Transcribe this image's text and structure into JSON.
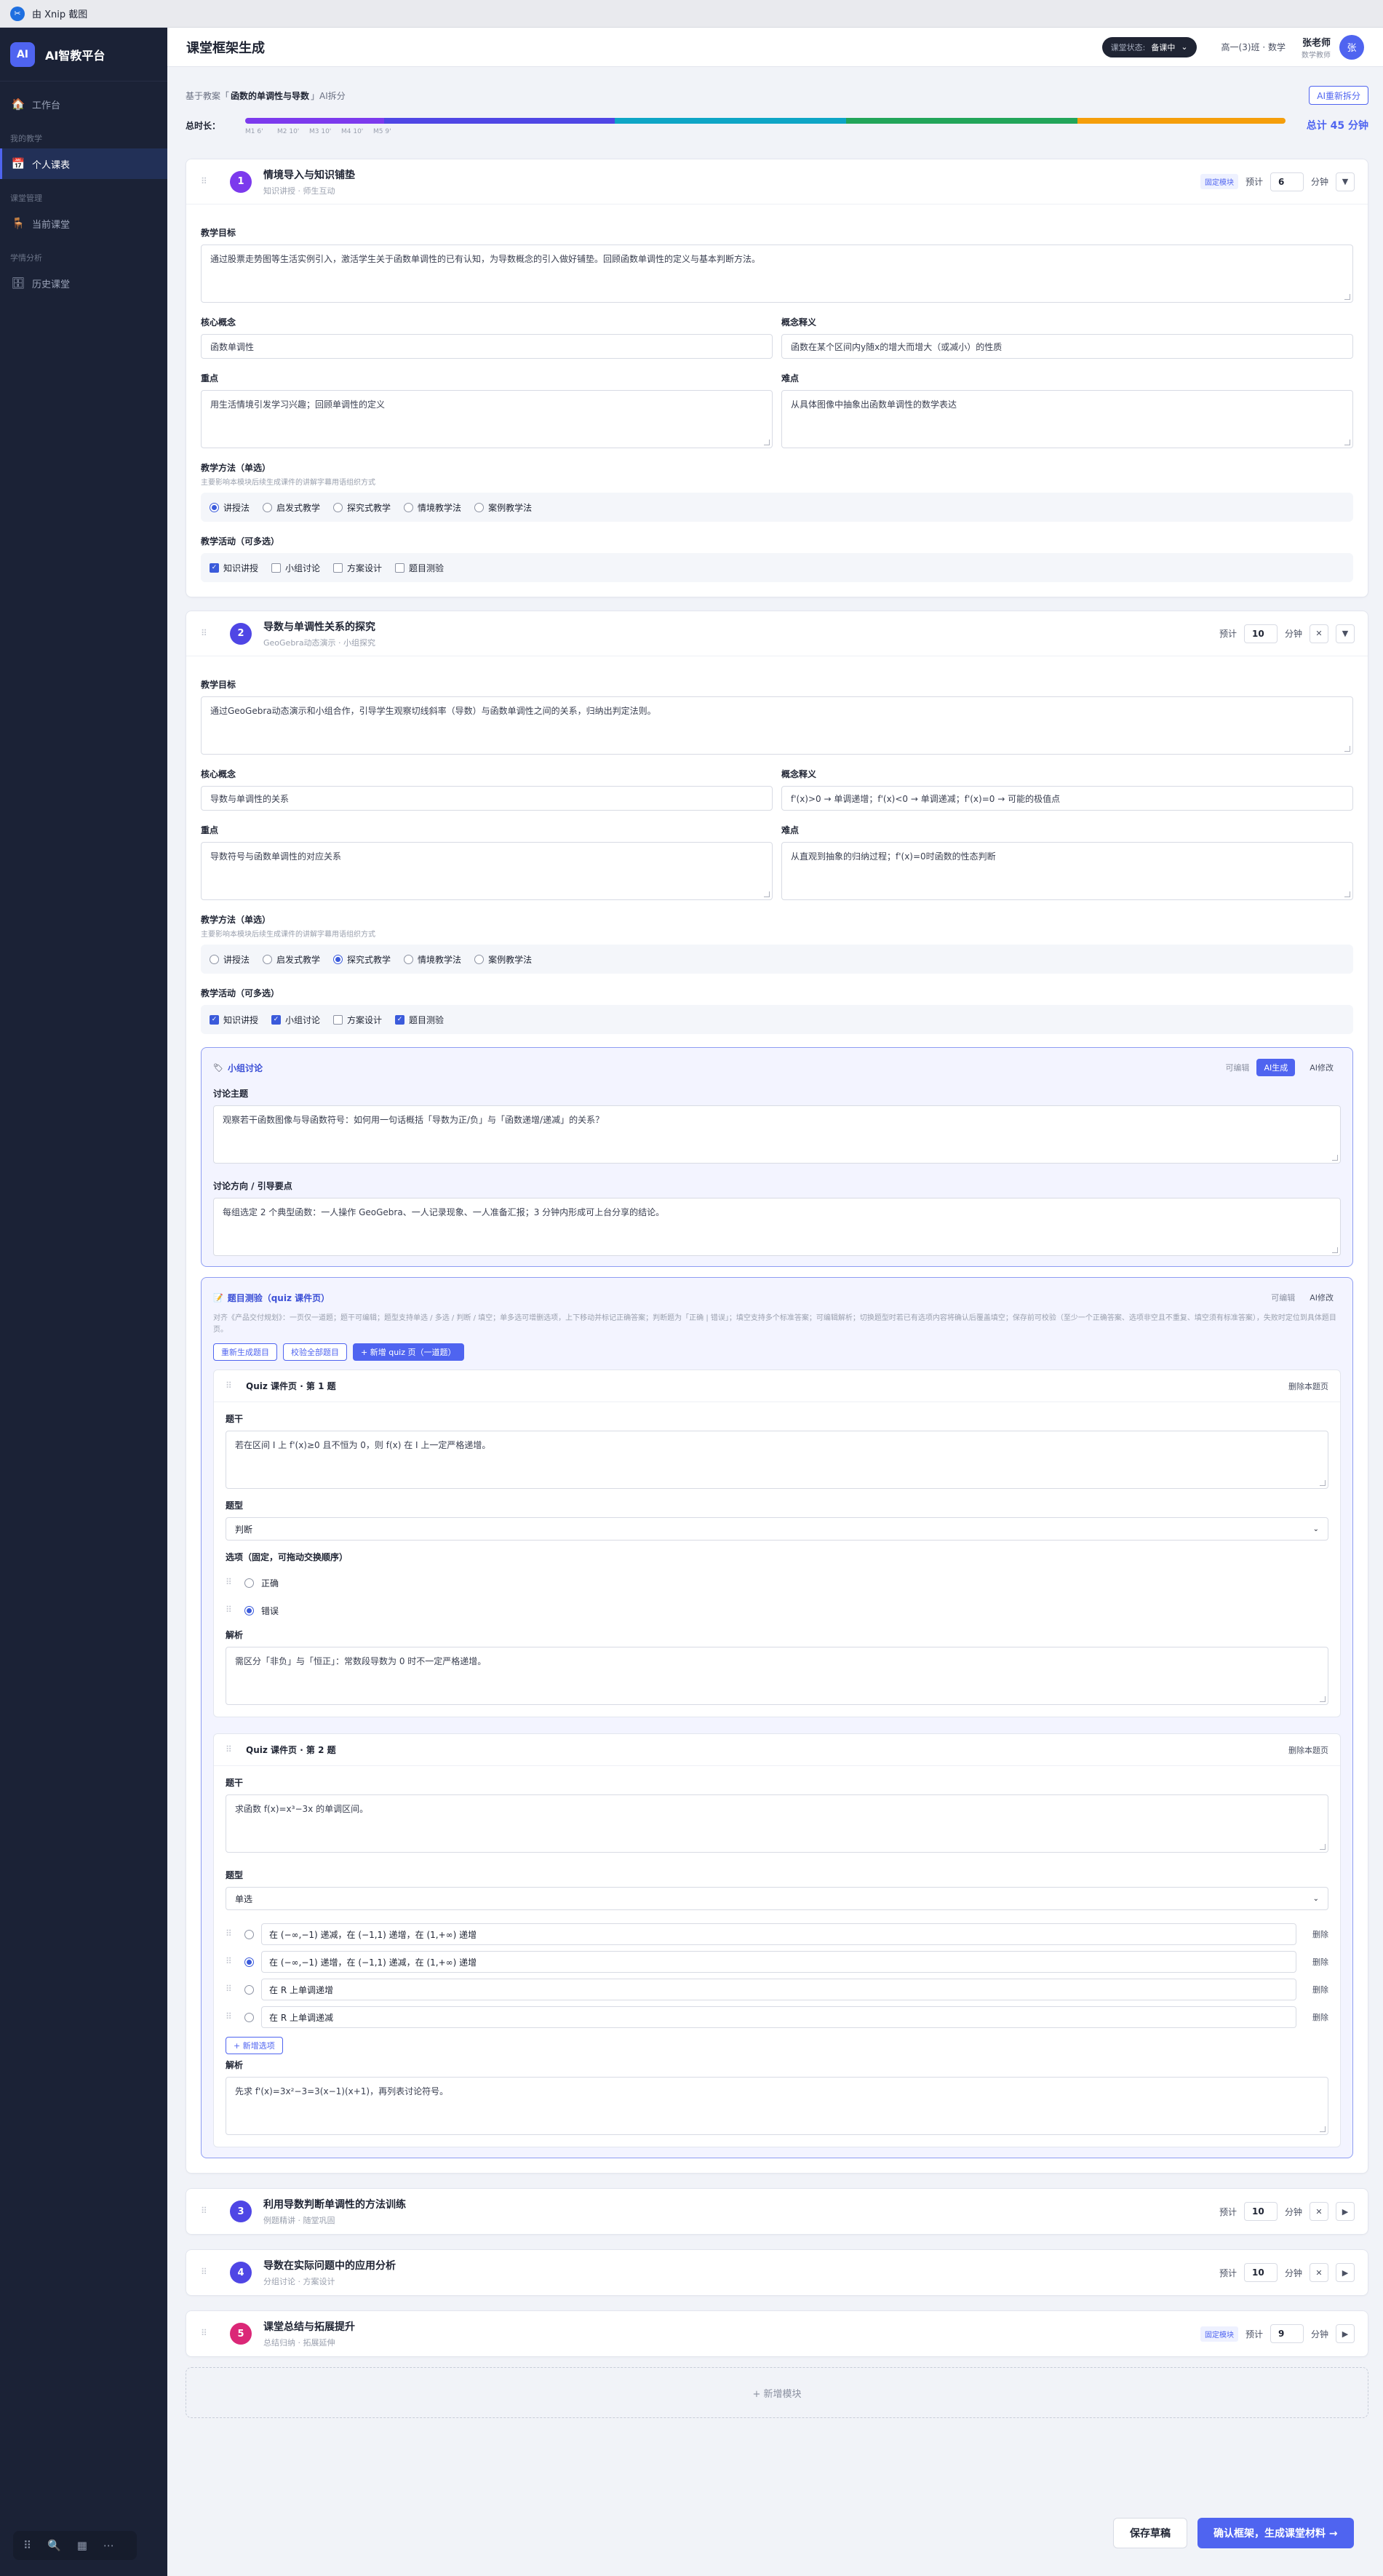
{
  "titlebar": {
    "title": "由 Xnip 截图"
  },
  "sidebar": {
    "brand": "AI智教平台",
    "logo": "AI",
    "workspace": "工作台",
    "groups": [
      {
        "label": "我的教学",
        "item": "个人课表"
      },
      {
        "label": "课堂管理",
        "item": "当前课堂"
      },
      {
        "label": "学情分析",
        "item": "历史课堂"
      }
    ]
  },
  "header": {
    "title": "课堂框架生成",
    "status_label": "课堂状态:",
    "status_value": "备课中",
    "class_info": "高一(3)班 · 数学",
    "user_name": "张老师",
    "user_role": "数学教师",
    "avatar": "张"
  },
  "basis": {
    "prefix": "基于教案「",
    "plan": "函数的单调性与导数",
    "suffix": "」AI拆分",
    "regenerate": "AI重新拆分"
  },
  "timeline": {
    "label": "总时长：",
    "total": "总计 45 分钟",
    "ticks": [
      "M1 6'",
      "M2 10'",
      "M3 10'",
      "M4 10'",
      "M5 9'"
    ],
    "minutes": [
      6,
      10,
      10,
      10,
      9
    ],
    "colors": [
      "#7c3aed",
      "#4f46e5",
      "#0ea5c6",
      "#22a55a",
      "#f59e0b"
    ]
  },
  "labels": {
    "goal": "教学目标",
    "concept": "核心概念",
    "concept_def": "概念释义",
    "key": "重点",
    "difficult": "难点",
    "method": "教学方法（单选）",
    "method_hint": "主要影响本模块后续生成课件的讲解字幕用语组织方式",
    "activity": "教学活动（可多选）",
    "est": "预计",
    "minute": "分钟",
    "fixed": "固定模块"
  },
  "methods": [
    "讲授法",
    "启发式教学",
    "探究式教学",
    "情境教学法",
    "案例教学法"
  ],
  "activities": [
    "知识讲授",
    "小组讨论",
    "方案设计",
    "题目测验"
  ],
  "modules": [
    {
      "num": "1",
      "color": "#7c3aed",
      "title": "情境导入与知识铺垫",
      "sub": "知识讲授 · 师生互动",
      "minutes": "6",
      "goal": "通过股票走势图等生活实例引入，激活学生关于函数单调性的已有认知，为导数概念的引入做好铺垫。回顾函数单调性的定义与基本判断方法。",
      "concept": "函数单调性",
      "concept_def": "函数在某个区间内y随x的增大而增大（或减小）的性质",
      "key": "用生活情境引发学习兴趣；回顾单调性的定义",
      "difficult": "从具体图像中抽象出函数单调性的数学表达"
    },
    {
      "num": "2",
      "color": "#4f46e5",
      "title": "导数与单调性关系的探究",
      "sub": "GeoGebra动态演示 · 小组探究",
      "minutes": "10",
      "goal": "通过GeoGebra动态演示和小组合作，引导学生观察切线斜率（导数）与函数单调性之间的关系，归纳出判定法则。",
      "concept": "导数与单调性的关系",
      "concept_def": "f'(x)>0 → 单调递增；f'(x)<0 → 单调递减；f'(x)=0 → 可能的极值点",
      "key": "导数符号与函数单调性的对应关系",
      "difficult": "从直观到抽象的归纳过程；f'(x)=0时函数的性态判断"
    },
    {
      "num": "3",
      "color": "#4f46e5",
      "title": "利用导数判断单调性的方法训练",
      "sub": "例题精讲 · 随堂巩固",
      "minutes": "10"
    },
    {
      "num": "4",
      "color": "#4f46e5",
      "title": "导数在实际问题中的应用分析",
      "sub": "分组讨论 · 方案设计",
      "minutes": "10"
    },
    {
      "num": "5",
      "color": "#db2777",
      "title": "课堂总结与拓展提升",
      "sub": "总结归纳 · 拓展延伸",
      "minutes": "9"
    }
  ],
  "group_panel": {
    "title": "小组讨论",
    "editable": "可编辑",
    "ai_gen": "AI生成",
    "ai_edit": "AI修改",
    "topic_label": "讨论主题",
    "topic": "观察若干函数图像与导函数符号：如何用一句话概括「导数为正/负」与「函数递增/递减」的关系？",
    "guide_label": "讨论方向 / 引导要点",
    "guide": "每组选定 2 个典型函数：一人操作 GeoGebra、一人记录现象、一人准备汇报；3 分钟内形成可上台分享的结论。"
  },
  "quiz_panel": {
    "title": "题目测验（quiz 课件页）",
    "editable": "可编辑",
    "ai_edit": "AI修改",
    "desc": "对齐《产品交付规划》：一页仅一道题；题干可编辑；题型支持单选 / 多选 / 判断 / 填空；单多选可增删选项，上下移动并标记正确答案；判断题为「正确 | 错误」；填空支持多个标准答案；可编辑解析；切换题型时若已有选项内容将确认后覆盖填空；保存前可校验（至少一个正确答案、选项非空且不重复、填空须有标准答案），失败时定位到具体题目页。",
    "regen": "重新生成题目",
    "validate": "校验全部题目",
    "add": "+ 新增 quiz 页（一道题）",
    "stem_label": "题干",
    "type_label": "题型",
    "options_label": "选项（固定，可拖动交换顺序）",
    "analysis_label": "解析",
    "delete_page": "删除本题页",
    "add_option": "+ 新增选项",
    "delete_opt": "删除",
    "q1": {
      "title": "Quiz 课件页 · 第 1 题",
      "stem": "若在区间 I 上 f'(x)≥0 且不恒为 0，则 f(x) 在 I 上一定严格递增。",
      "type": "判断",
      "options": [
        "正确",
        "错误"
      ],
      "analysis": "需区分「非负」与「恒正」：常数段导数为 0 时不一定严格递增。"
    },
    "q2": {
      "title": "Quiz 课件页 · 第 2 题",
      "stem": "求函数 f(x)=x³−3x 的单调区间。",
      "type": "单选",
      "options": [
        "在 (−∞,−1) 递减，在 (−1,1) 递增，在 (1,+∞) 递增",
        "在 (−∞,−1) 递增，在 (−1,1) 递减，在 (1,+∞) 递增",
        "在 R 上单调递增",
        "在 R 上单调递减"
      ],
      "analysis": "先求 f'(x)=3x²−3=3(x−1)(x+1)，再列表讨论符号。"
    }
  },
  "footer": {
    "add_module": "+ 新增模块",
    "save": "保存草稿",
    "confirm": "确认框架，生成课堂材料 →"
  }
}
